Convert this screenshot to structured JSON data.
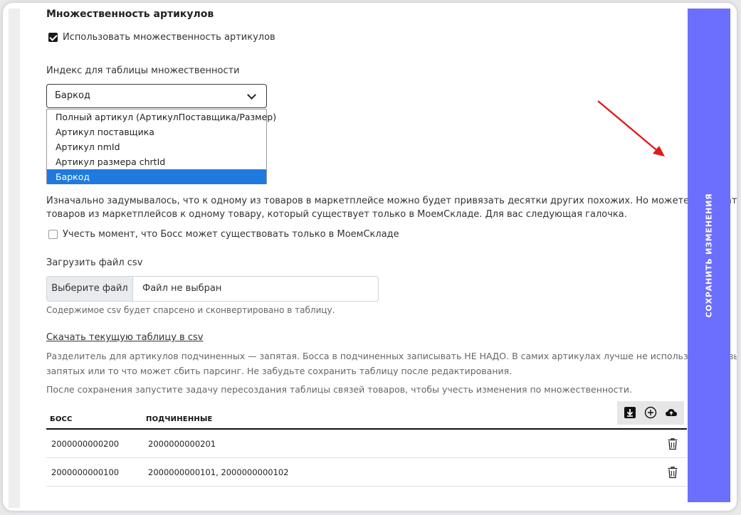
{
  "section": {
    "title": "Множественность артикулов",
    "use_multiplicity_label": "Использовать множественность артикулов",
    "use_multiplicity_checked": true
  },
  "index": {
    "label": "Индекс для таблицы множественности",
    "selected": "Баркод",
    "options": [
      "Полный артикул (АртикулПоставщика/Размер)",
      "Артикул поставщика",
      "Артикул nmId",
      "Артикул размера chrtId",
      "Баркод"
    ]
  },
  "info": {
    "line1": "Изначально задумывалось, что к одному из товаров в маркетплейсе можно будет привязать десятки других похожих. Но можете привязать кучу",
    "line2": "товаров из маркетплейсов к одному товару, который существует только в МоемСкладе. Для вас следующая галочка.",
    "boss_label": "Учесть момент, что Босс может существовать только в МоемСкладе",
    "boss_checked": false
  },
  "upload": {
    "label": "Загрузить файл csv",
    "button": "Выберите файл",
    "filename": "Файл не выбран",
    "hint": "Содержимое csv будет спарсено и сконвертировано в таблицу."
  },
  "download": {
    "link": "Скачать текущую таблицу в csv",
    "note1": "Разделитель для артикулов подчиненных — запятая. Босса в подчиненных записывать НЕ НАДО. В самих артикулах лучше не использовать кавыче",
    "note2": "запятых или то что может сбить парсинг. Не забудьте сохранить таблицу после редактирования.",
    "note3": "После сохранения запустите задачу пересоздания таблицы связей товаров, чтобы учесть изменения по множественности."
  },
  "table": {
    "headers": [
      "БОСС",
      "ПОДЧИНЕННЫЕ"
    ],
    "rows": [
      {
        "boss": "2000000000200",
        "subs": "2000000000201"
      },
      {
        "boss": "2000000000100",
        "subs": "2000000000101, 2000000000102"
      }
    ],
    "toolbar_icons": [
      "download-icon",
      "add-circle-icon",
      "cloud-upload-icon"
    ],
    "row_icon": "trash-icon"
  },
  "save": {
    "label": "СОХРАНИТЬ ИЗМЕНЕНИЯ",
    "color": "#6c6ffd"
  },
  "colors": {
    "selected_option": "#1f7ae0",
    "arrow": "#e01b1b"
  }
}
